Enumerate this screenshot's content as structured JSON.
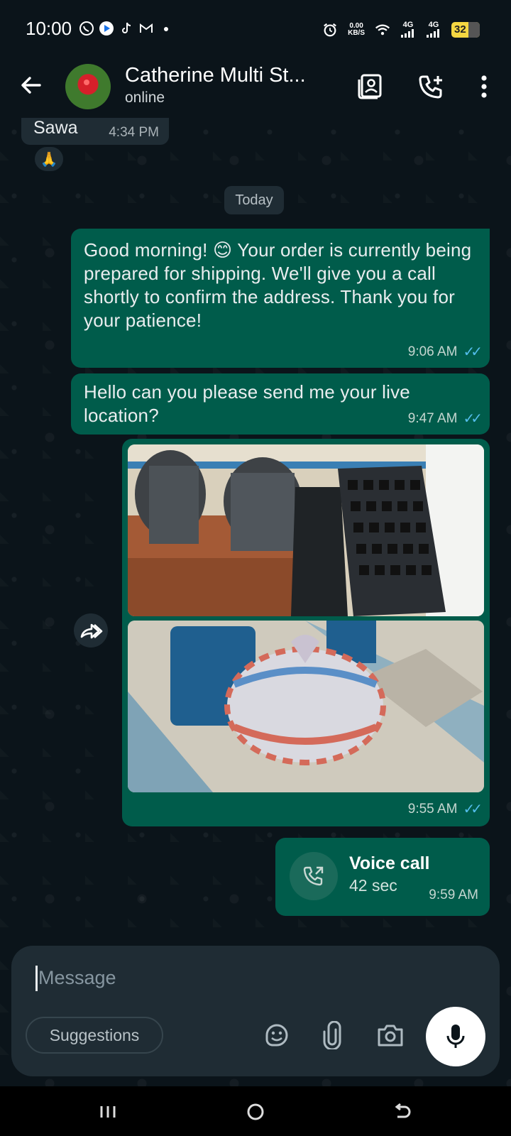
{
  "status_bar": {
    "time": "10:00",
    "speed_top": "0.00",
    "speed_bottom": "KB/S",
    "net1": "4G",
    "net2": "4G",
    "battery": "32"
  },
  "header": {
    "contact_name": "Catherine Multi St...",
    "status": "online"
  },
  "messages": {
    "incoming": {
      "text": "Sawa",
      "time": "4:34 PM",
      "reaction": "🙏"
    },
    "date_divider": "Today",
    "m1": {
      "text": "Good morning! 😊 Your order is currently being prepared for shipping. We'll give you a call shortly to confirm the address. Thank you for your patience!",
      "time": "9:06 AM"
    },
    "m2": {
      "text": "Hello can you please send me your live location?",
      "time": "9:47 AM"
    },
    "m3": {
      "time": "9:55 AM"
    },
    "m4": {
      "title": "Voice call",
      "duration": "42 sec",
      "time": "9:59 AM"
    }
  },
  "composer": {
    "placeholder": "Message",
    "suggestions": "Suggestions"
  },
  "colors": {
    "outgoing_bubble": "#005c4b",
    "incoming_bubble": "#1f2c34",
    "read_ticks": "#53bdeb",
    "background": "#0b141a"
  }
}
